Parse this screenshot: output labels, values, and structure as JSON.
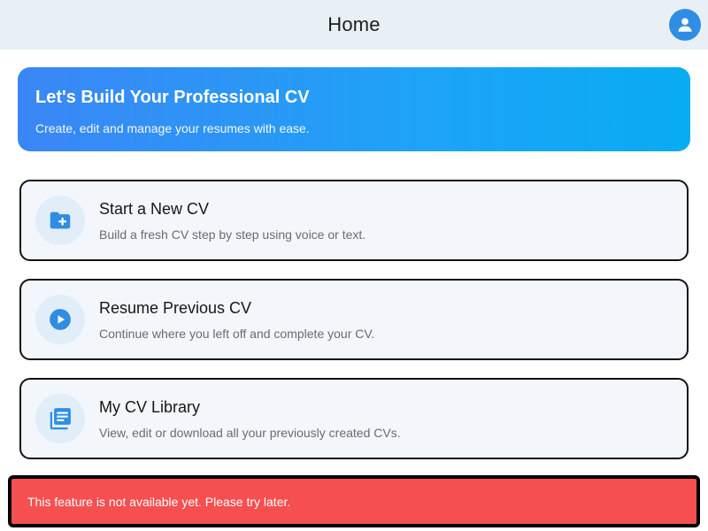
{
  "appbar": {
    "title": "Home",
    "avatar_icon": "account-icon"
  },
  "hero": {
    "title": "Let's Build Your Professional CV",
    "subtitle": "Create, edit and manage your resumes with ease.",
    "gradient_start": "#3b86f6",
    "gradient_end": "#08acf2"
  },
  "cards": [
    {
      "icon": "folder-add-icon",
      "title": "Start a New CV",
      "description": "Build a fresh CV step by step using voice or text."
    },
    {
      "icon": "play-circle-icon",
      "title": "Resume Previous CV",
      "description": "Continue where you left off and complete your CV."
    },
    {
      "icon": "library-icon",
      "title": "My CV Library",
      "description": "View, edit or download all your previously created CVs."
    }
  ],
  "snackbar": {
    "message": "This feature is not available yet. Please try later.",
    "color": "#f64f50"
  },
  "colors": {
    "accent": "#2f8de4",
    "card_background": "#f3f7fb",
    "appbar_background": "#e8f0f6"
  }
}
